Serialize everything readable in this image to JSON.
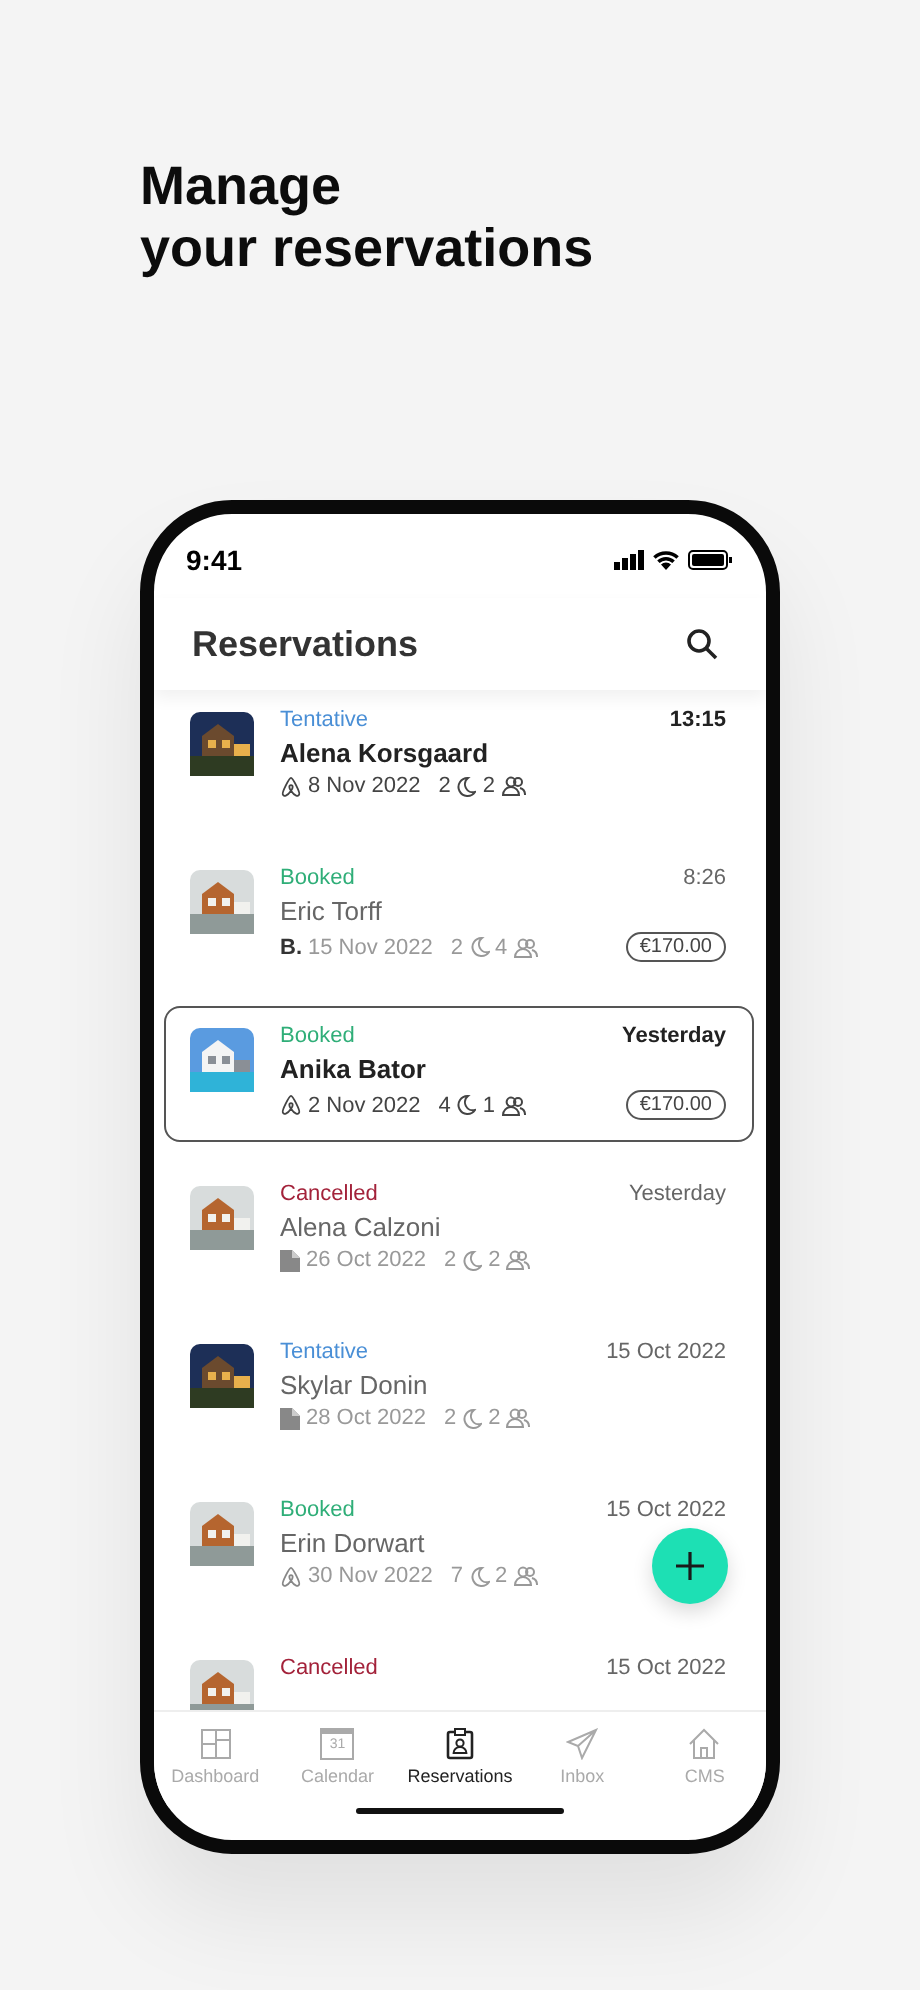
{
  "headline": [
    "Manage",
    "your reservations"
  ],
  "status_bar": {
    "time": "9:41"
  },
  "header": {
    "title": "Reservations"
  },
  "reservations": [
    {
      "status": "Tentative",
      "color": "#4a8fd6",
      "time": "13:15",
      "name": "Alena Korsgaard",
      "unread": true,
      "selected": false,
      "kind": "airbnb",
      "date": "8 Nov 2022",
      "nights": "2",
      "guests": "2"
    },
    {
      "status": "Booked",
      "color": "#2fae78",
      "time": "8:26",
      "name": "Eric Torff",
      "unread": false,
      "selected": false,
      "kind": "booking",
      "source_label": "B.",
      "date": "15 Nov 2022",
      "nights": "2",
      "guests": "4",
      "price": "€170.00"
    },
    {
      "status": "Booked",
      "color": "#2fae78",
      "time": "Yesterday",
      "name": "Anika Bator",
      "unread": true,
      "selected": true,
      "kind": "airbnb",
      "date": "2 Nov 2022",
      "nights": "4",
      "guests": "1",
      "price": "€170.00"
    },
    {
      "status": "Cancelled",
      "color": "#a3223a",
      "time": "Yesterday",
      "name": "Alena Calzoni",
      "unread": false,
      "selected": false,
      "kind": "direct",
      "date": "26 Oct 2022",
      "nights": "2",
      "guests": "2"
    },
    {
      "status": "Tentative",
      "color": "#4a8fd6",
      "time": "15 Oct 2022",
      "name": "Skylar Donin",
      "unread": false,
      "selected": false,
      "kind": "direct",
      "date": "28 Oct 2022",
      "nights": "2",
      "guests": "2"
    },
    {
      "status": "Booked",
      "color": "#2fae78",
      "time": "15 Oct 2022",
      "name": "Erin Dorwart",
      "unread": false,
      "selected": false,
      "kind": "airbnb",
      "date": "30 Nov 2022",
      "nights": "7",
      "guests": "2"
    },
    {
      "status": "Cancelled",
      "color": "#a3223a",
      "time": "15 Oct 2022",
      "unread": false,
      "selected": false
    }
  ],
  "tabs": [
    {
      "label": "Dashboard",
      "selected": false
    },
    {
      "label": "Calendar",
      "icon_text": "31",
      "selected": false
    },
    {
      "label": "Reservations",
      "selected": true
    },
    {
      "label": "Inbox",
      "selected": false
    },
    {
      "label": "CMS",
      "selected": false
    }
  ]
}
